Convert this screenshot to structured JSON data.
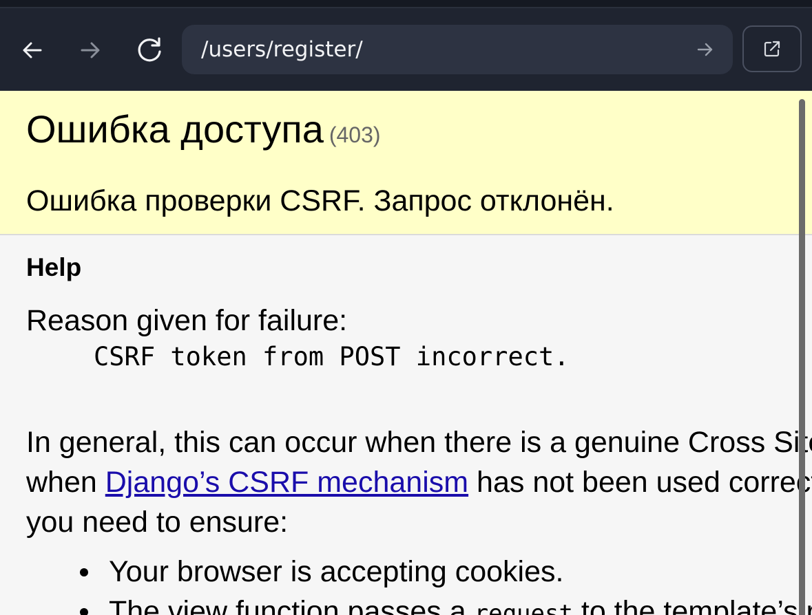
{
  "browser": {
    "url": "/users/register/",
    "back_icon": "arrow-left-icon",
    "forward_icon": "arrow-right-icon",
    "reload_icon": "reload-icon",
    "go_icon": "arrow-right-icon",
    "open_external_icon": "external-link-icon"
  },
  "error": {
    "title": "Ошибка доступа",
    "code": "(403)",
    "message": "Ошибка проверки CSRF. Запрос отклонён."
  },
  "help": {
    "title": "Help",
    "reason_label": "Reason given for failure:",
    "reason_value": "CSRF token from POST incorrect.",
    "para_line1": "In general, this can occur when there is a genuine Cross Site Request Forgery, or",
    "para_line2_before": "when ",
    "para_link": "Django’s CSRF mechanism",
    "para_line2_after": " has not been used correctly. For POST forms,",
    "para_line3": "you need to ensure:",
    "items": [
      {
        "text": "Your browser is accepting cookies."
      },
      {
        "before": "The view function passes a ",
        "code": "request",
        "after": " to the template’s render method."
      }
    ]
  },
  "colors": {
    "toolbar_bg": "#1f2430",
    "urlbar_bg": "#2d3342",
    "summary_bg": "#ffffc8",
    "link": "#1a0dab"
  }
}
